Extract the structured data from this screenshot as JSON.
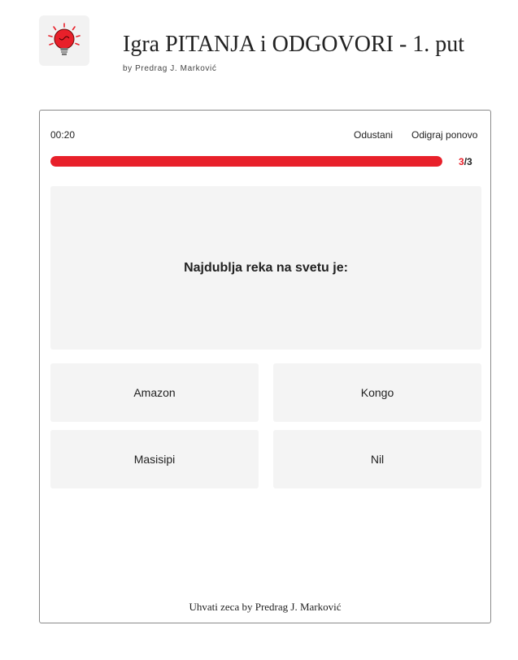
{
  "header": {
    "title": "Igra PITANJA i ODGOVORI - 1. put",
    "byline": "by Predrag J. Marković",
    "logo_icon": "lightbulb-icon",
    "brand_color": "#e8202a"
  },
  "game": {
    "timer": "00:20",
    "quit_label": "Odustani",
    "replay_label": "Odigraj ponovo",
    "progress": {
      "current": "3",
      "separator_total": "/3",
      "fraction": 1.0
    },
    "question": "Najdublja reka na svetu je:",
    "answers": [
      "Amazon",
      "Kongo",
      "Masisipi",
      "Nil"
    ]
  },
  "footer": {
    "text": "Uhvati zeca by Predrag J. Marković"
  }
}
